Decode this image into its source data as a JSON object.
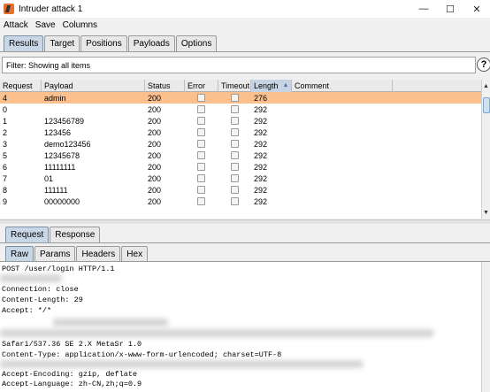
{
  "window": {
    "title": "Intruder attack 1",
    "controls": [
      "—",
      "☐",
      "✕"
    ]
  },
  "menu": [
    "Attack",
    "Save",
    "Columns"
  ],
  "top_tabs": [
    "Results",
    "Target",
    "Positions",
    "Payloads",
    "Options"
  ],
  "filter": {
    "text": "Filter: Showing all items",
    "help": "?"
  },
  "table": {
    "columns": [
      "Request",
      "Payload",
      "Status",
      "Error",
      "Timeout",
      "Length",
      "Comment"
    ],
    "sorted_column": "Length",
    "rows": [
      {
        "request": "4",
        "payload": "admin",
        "status": "200",
        "length": "276",
        "selected": true
      },
      {
        "request": "0",
        "payload": "",
        "status": "200",
        "length": "292",
        "selected": false
      },
      {
        "request": "1",
        "payload": "123456789",
        "status": "200",
        "length": "292",
        "selected": false
      },
      {
        "request": "2",
        "payload": "123456",
        "status": "200",
        "length": "292",
        "selected": false
      },
      {
        "request": "3",
        "payload": "demo123456",
        "status": "200",
        "length": "292",
        "selected": false
      },
      {
        "request": "5",
        "payload": "12345678",
        "status": "200",
        "length": "292",
        "selected": false
      },
      {
        "request": "6",
        "payload": "11111111",
        "status": "200",
        "length": "292",
        "selected": false
      },
      {
        "request": "7",
        "payload": "01",
        "status": "200",
        "length": "292",
        "selected": false
      },
      {
        "request": "8",
        "payload": "111111",
        "status": "200",
        "length": "292",
        "selected": false
      },
      {
        "request": "9",
        "payload": "00000000",
        "status": "200",
        "length": "292",
        "selected": false
      }
    ]
  },
  "mid_tabs": [
    "Request",
    "Response"
  ],
  "sub_tabs": [
    "Raw",
    "Params",
    "Headers",
    "Hex"
  ],
  "editor": {
    "lines": [
      "POST /user/login HTTP/1.1",
      "Connection: close",
      "Content-Length: 29",
      "Accept: */*",
      "Safari/537.36 SE 2.X MetaSr 1.0",
      "Content-Type: application/x-www-form-urlencoded; charset=UTF-8",
      "Accept-Encoding: gzip, deflate",
      "Accept-Language: zh-CN,zh;q=0.9"
    ]
  },
  "colors": {
    "selected_row": "#fcbf8e",
    "active_tab": "#c8d6e6"
  }
}
